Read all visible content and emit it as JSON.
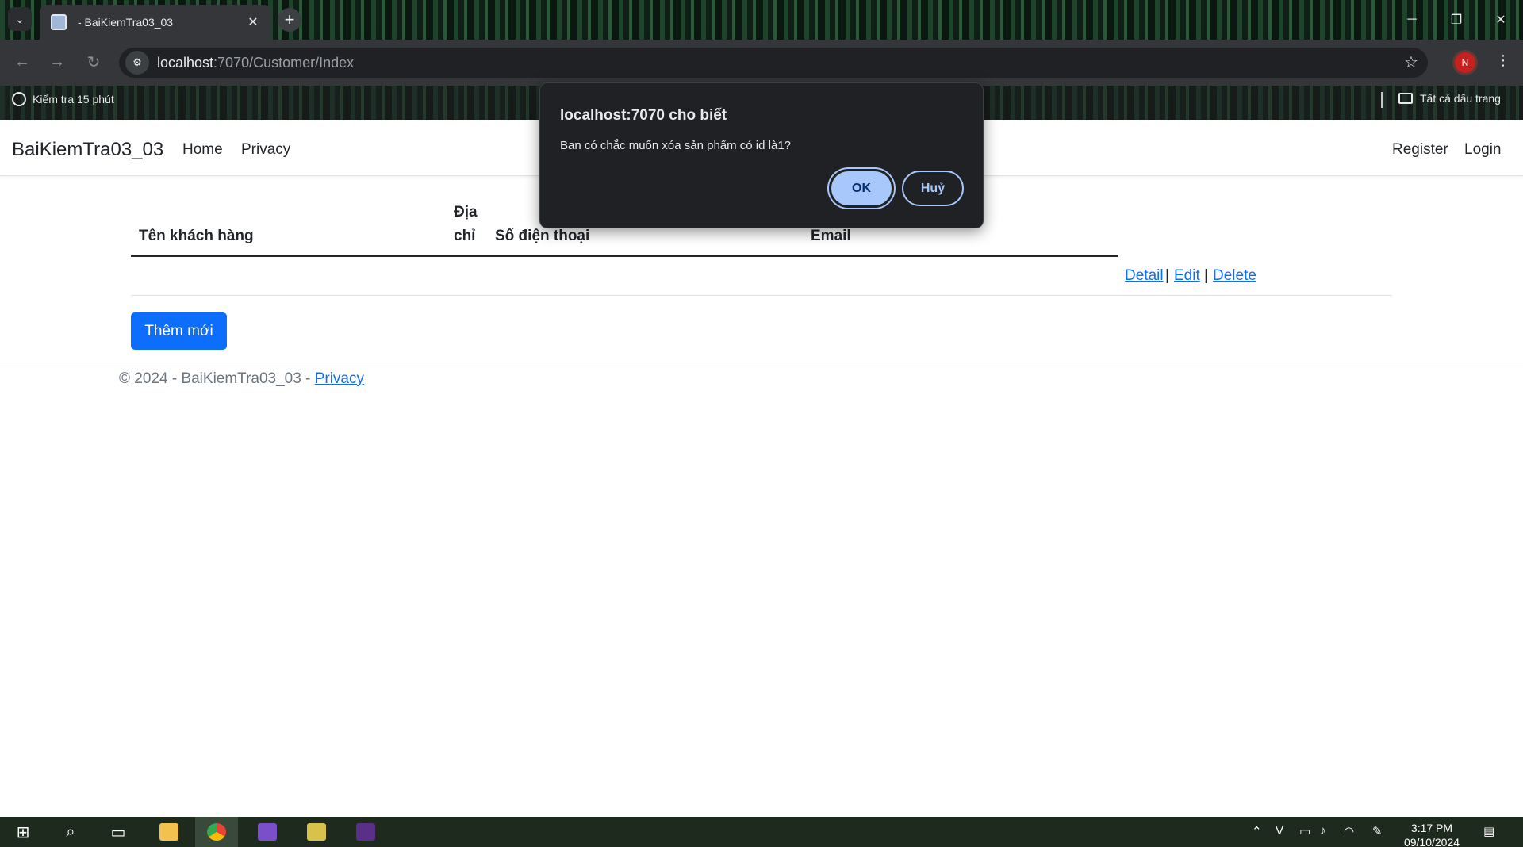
{
  "browser": {
    "tab_title": "- BaiKiemTra03_03",
    "url_host": "localhost",
    "url_path": ":7070/Customer/Index",
    "profile_initial": "N",
    "bookmarks": [
      {
        "label": "Kiểm tra 15 phút",
        "icon": "globe-icon"
      },
      {
        "label": "Tất cả dấu trang",
        "icon": "folder-icon"
      }
    ]
  },
  "navbar": {
    "brand": "BaiKiemTra03_03",
    "links": [
      "Home",
      "Privacy"
    ],
    "right_links": [
      "Register",
      "Login"
    ]
  },
  "table": {
    "headers": {
      "name": "Tên khách hàng",
      "address_line1": "Địa",
      "address_line2": "chỉ",
      "phone": "Số điện thoại",
      "email": "Email"
    },
    "row_actions": {
      "detail": "Detail",
      "edit": "Edit",
      "delete": "Delete"
    }
  },
  "add_button": "Thêm mới",
  "footer": {
    "text": "© 2024 - BaiKiemTra03_03 - ",
    "link": "Privacy"
  },
  "dialog": {
    "title": "localhost:7070 cho biết",
    "message": "Ban có chắc muốn xóa sản phẩm có id là1?",
    "ok": "OK",
    "cancel": "Huỷ"
  },
  "taskbar": {
    "time": "3:17 PM",
    "date": "09/10/2024"
  },
  "colors": {
    "primary": "#0d6efd",
    "dialog_bg": "#202124",
    "dialog_accent": "#a8c7fa"
  }
}
